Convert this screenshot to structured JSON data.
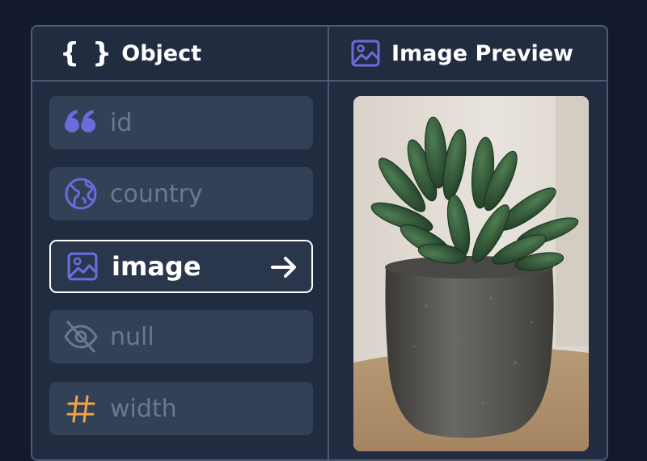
{
  "header": {
    "object_label": "Object",
    "preview_label": "Image Preview"
  },
  "fields": [
    {
      "label": "id",
      "icon": "quote-icon",
      "color": "#6b6bdc"
    },
    {
      "label": "country",
      "icon": "globe-icon",
      "color": "#6b6bdc"
    },
    {
      "label": "image",
      "icon": "image-icon",
      "color": "#6b6bdc",
      "active": true
    },
    {
      "label": "null",
      "icon": "eye-off-icon",
      "color": "#6a7890"
    },
    {
      "label": "width",
      "icon": "hash-icon",
      "color": "#f0a44a"
    }
  ],
  "colors": {
    "background": "#141a2d",
    "panel": "#222c41",
    "field": "#334157",
    "border": "#4d5a72",
    "accent": "#6b6bdc"
  }
}
